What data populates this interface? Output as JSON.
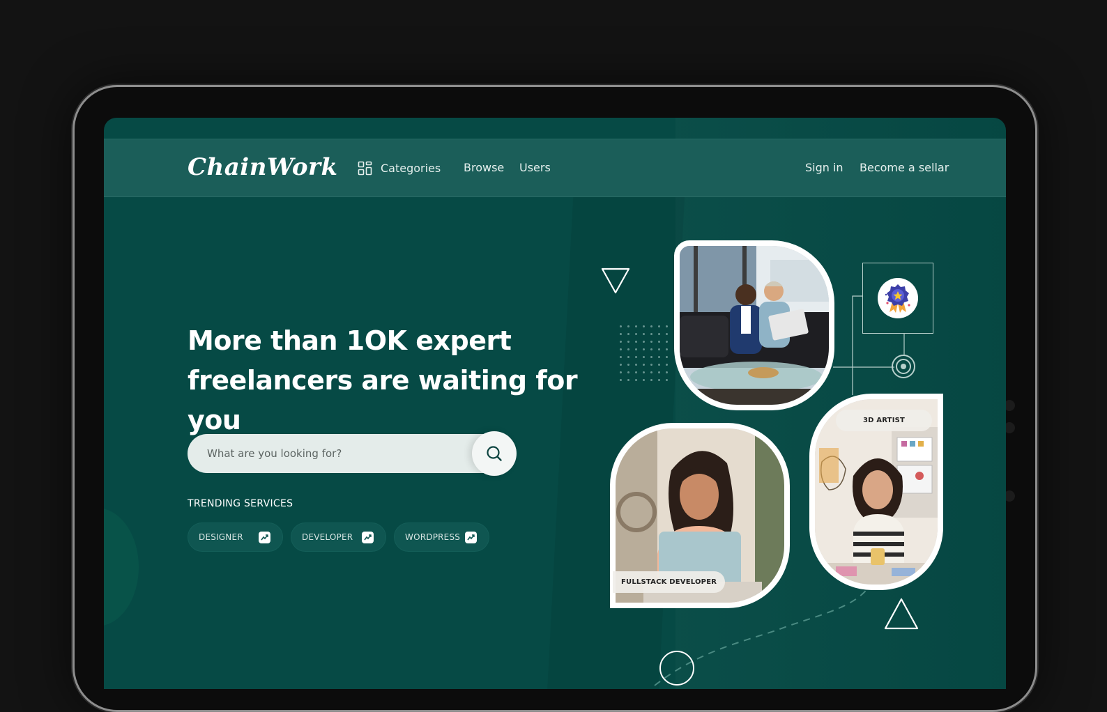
{
  "brand": {
    "logo_text": "ChainWork"
  },
  "nav": {
    "categories_label": "Categories",
    "browse_label": "Browse",
    "users_label": "Users",
    "signin_label": "Sign in",
    "seller_label": "Become a sellar"
  },
  "hero": {
    "title_line1": "More than 1OK expert",
    "title_line2": "freelancers are waiting for you"
  },
  "search": {
    "placeholder": "What are you looking for?"
  },
  "trending": {
    "heading": "TRENDING SERVICES",
    "chips": [
      {
        "label": "DESIGNER",
        "icon": "trending-up-icon"
      },
      {
        "label": "DEVELOPER",
        "icon": "trending-up-icon"
      },
      {
        "label": "WORDPRESS",
        "icon": "trending-up-icon"
      }
    ]
  },
  "illustration": {
    "fullstack_label": "FULLSTACK DEVELOPER",
    "artist_label": "3D ARTIST",
    "award_icon": "award-badge-icon"
  },
  "colors": {
    "background": "#064a45",
    "header": "#1b5e59",
    "chip": "#0f5651",
    "search_field": "#e4ecea",
    "text": "#ffffff"
  }
}
